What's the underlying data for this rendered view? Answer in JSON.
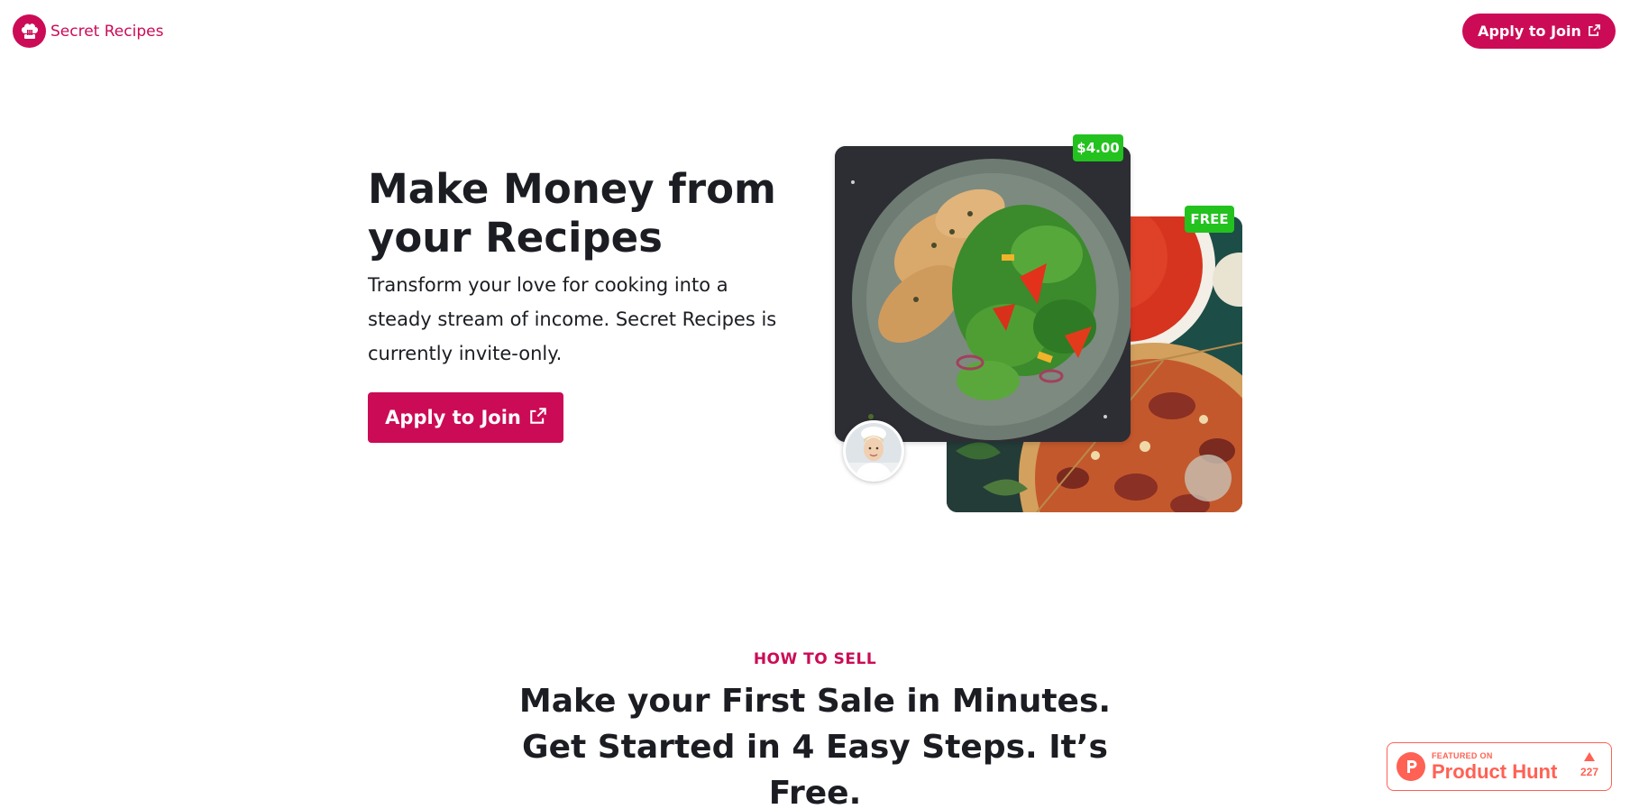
{
  "header": {
    "brand_name": "Secret Recipes",
    "logo_icon": "chef-hat-icon",
    "cta_label": "Apply to Join",
    "cta_icon": "external-link-icon"
  },
  "hero": {
    "title": "Make Money from your Recipes",
    "subtitle": "Transform your love for cooking into a steady stream of income. Secret Recipes is currently invite-only.",
    "cta_label": "Apply to Join",
    "cta_icon": "external-link-icon",
    "images": {
      "front": {
        "subject": "chicken salad bowl",
        "badge": "$4.00"
      },
      "back": {
        "subject": "tomato soup and pizza",
        "badge": "FREE"
      },
      "avatar": "chef-avatar"
    }
  },
  "how_to_sell": {
    "eyebrow": "HOW TO SELL",
    "title": "Make your First Sale in Minutes. Get Started in 4 Easy Steps. It’s Free."
  },
  "product_hunt": {
    "featured_label": "FEATURED ON",
    "name": "Product Hunt",
    "votes": "227"
  },
  "colors": {
    "brand": "#cc0b56",
    "badge_green": "#23c21f",
    "product_hunt": "#ff6154",
    "text": "#1b1d22"
  }
}
